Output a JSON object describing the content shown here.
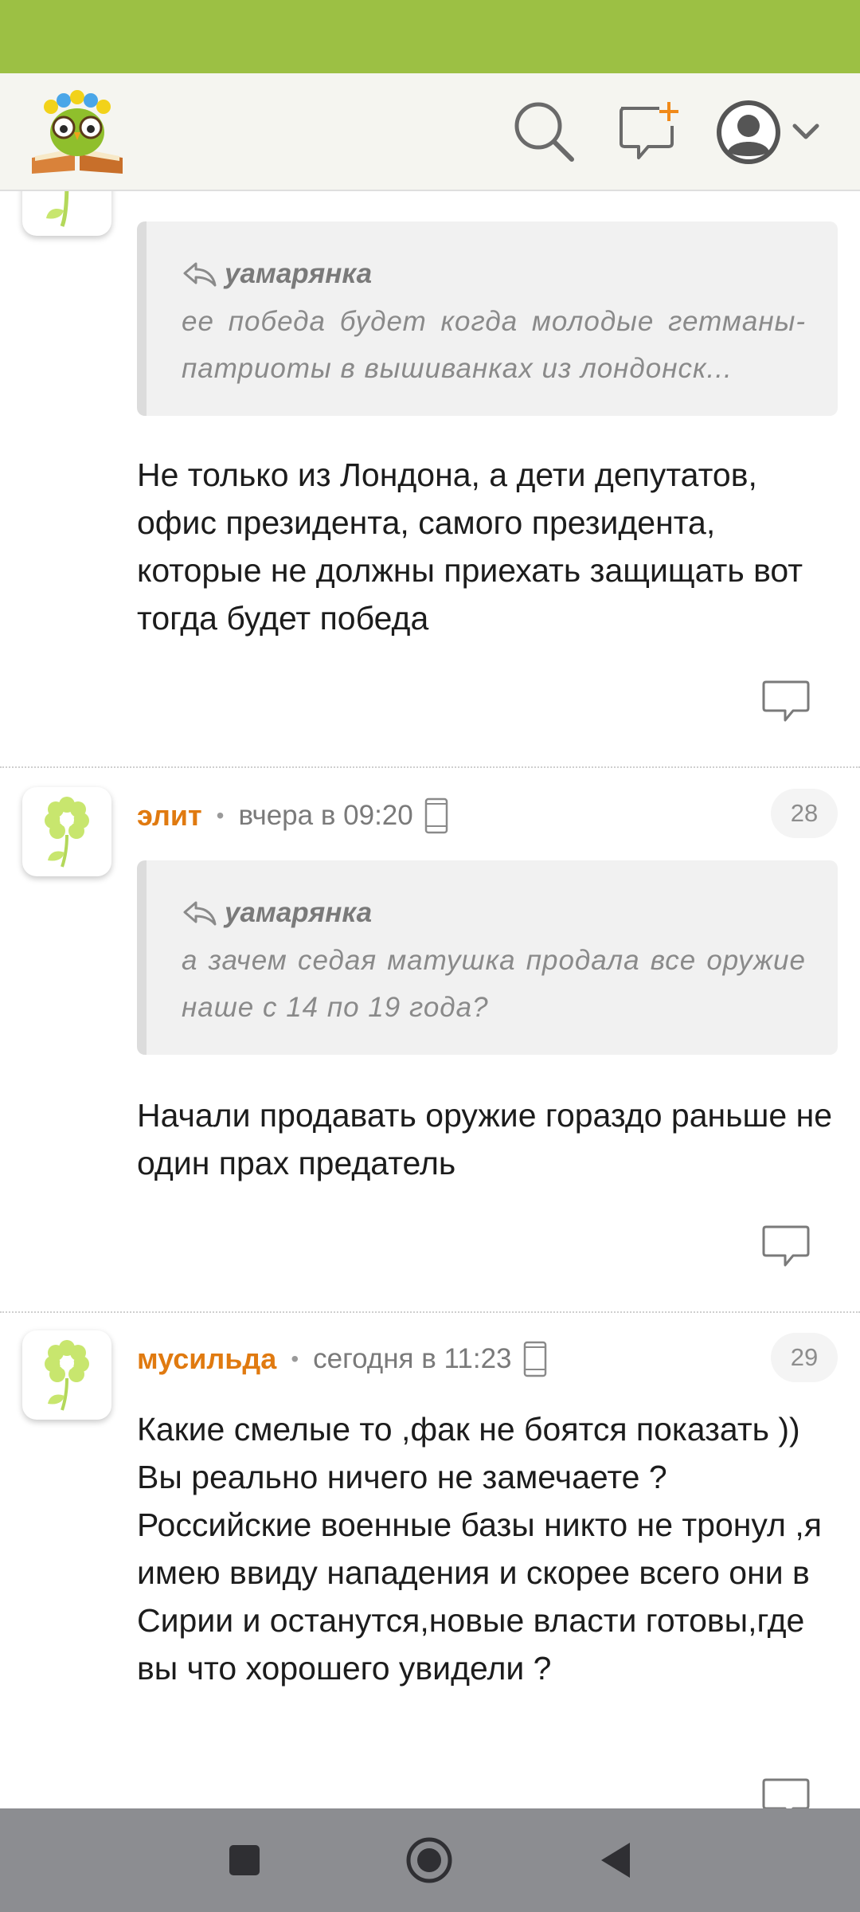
{
  "header": {
    "logo_icon": "owl-on-book-logo",
    "icons": [
      "search-icon",
      "new-message-icon",
      "user-avatar-icon",
      "chevron-down-icon"
    ]
  },
  "comments": [
    {
      "quote": {
        "author": "уамарянка",
        "text": "ее победа будет когда молодые гетманы-патриоты в вышиванках из лондонск..."
      },
      "text": "Не только из Лондона, а дети депутатов, офис президента, самого президента, которые не должны приехать защищать вот тогда будет победа"
    },
    {
      "author": "элит",
      "time": "вчера в 09:20",
      "device_icon": "mobile-phone-icon",
      "count": "28",
      "quote": {
        "author": "уамарянка",
        "text": "а зачем седая матушка продала все оружие наше с 14 по 19 года?"
      },
      "text": "Начали продавать оружие гораздо раньше не один прах предатель"
    },
    {
      "author": "мусильда",
      "time": "сегодня в 11:23",
      "device_icon": "mobile-phone-icon",
      "count": "29",
      "text": "Какие смелые то ,фак не боятся показать )) Вы реально ничего не замечаете ? Российские военные базы никто не тронул ,я имею ввиду нападения и скорее всего они в Сирии и останутся,новые власти готовы,где вы что хорошего увидели ?"
    }
  ],
  "colors": {
    "status_bar": "#9cc044",
    "author": "#e07a10",
    "nav_bar": "#8c8d91"
  },
  "nav": [
    "recent-apps-button",
    "home-button",
    "back-button"
  ]
}
